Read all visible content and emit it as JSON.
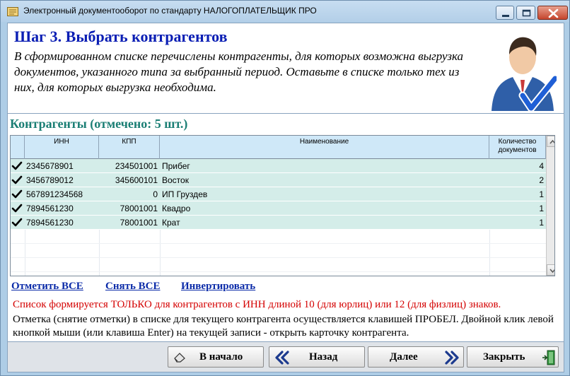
{
  "window": {
    "title": "Электронный документооборот по стандарту НАЛОГОПЛАТЕЛЬЩИК ПРО"
  },
  "header": {
    "title": "Шаг 3. Выбрать контрагентов",
    "description": "В сформированном списке перечислены контрагенты, для которых возможна выгрузка документов, указанного типа за выбранный период. Оставьте в списке только тех из них, для которых выгрузка необходима."
  },
  "section": {
    "title": "Контрагенты (отмечено: 5 шт.)"
  },
  "grid": {
    "columns": {
      "inn": "ИНН",
      "kpp": "КПП",
      "name": "Наименование",
      "count": "Количество документов"
    },
    "rows": [
      {
        "checked": true,
        "inn": "2345678901",
        "kpp": "234501001",
        "name": "Прибег",
        "count": "4"
      },
      {
        "checked": true,
        "inn": "3456789012",
        "kpp": "345600101",
        "name": "Восток",
        "count": "2"
      },
      {
        "checked": true,
        "inn": "567891234568",
        "kpp": "0",
        "name": "ИП Груздев",
        "count": "1"
      },
      {
        "checked": true,
        "inn": "7894561230",
        "kpp": "78001001",
        "name": "Квадро",
        "count": "1"
      },
      {
        "checked": true,
        "inn": "7894561230",
        "kpp": "78001001",
        "name": "Крат",
        "count": "1"
      }
    ]
  },
  "links": {
    "check_all": "Отметить ВСЕ",
    "uncheck_all": "Снять ВСЕ",
    "invert": "Инвертировать"
  },
  "notes": {
    "warning": "Список формируется ТОЛЬКО для контрагентов с ИНН длиной 10 (для юрлиц) или 12 (для физлиц) знаков.",
    "help": "Отметка (снятие отметки) в списке для текущего контрагента осуществляется клавишей ПРОБЕЛ. Двойной клик левой кнопкой мыши (или клавиша Enter) на текущей записи - открыть карточку контрагента."
  },
  "footer": {
    "start": "В начало",
    "back": "Назад",
    "next": "Далее",
    "close": "Закрыть"
  }
}
